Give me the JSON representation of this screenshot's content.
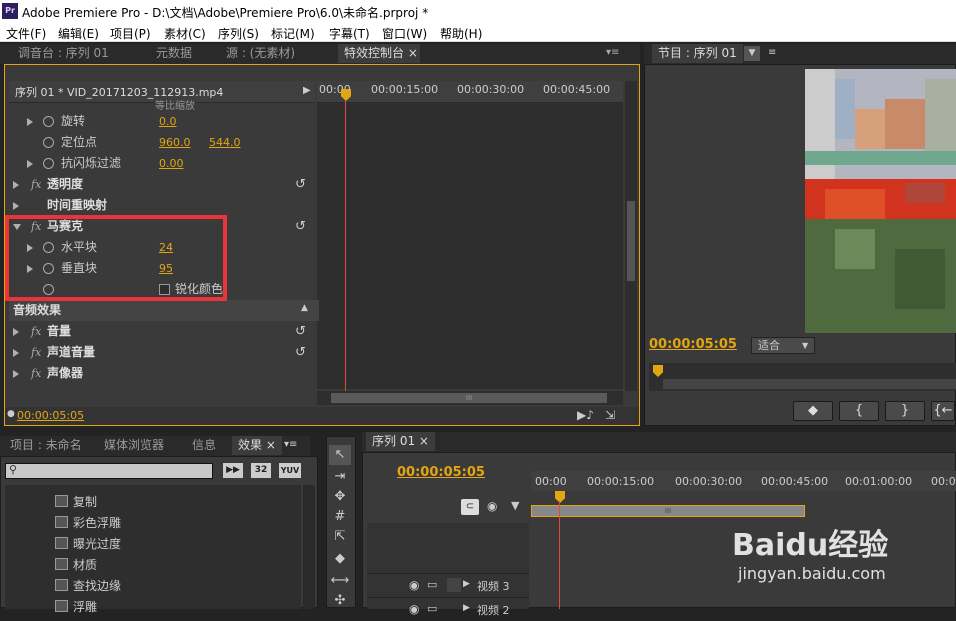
{
  "window": {
    "title": "Adobe Premiere Pro - D:\\文档\\Adobe\\Premiere Pro\\6.0\\未命名.prproj *",
    "logo": "Pr"
  },
  "menu": [
    "文件(F)",
    "编辑(E)",
    "项目(P)",
    "素材(C)",
    "序列(S)",
    "标记(M)",
    "字幕(T)",
    "窗口(W)",
    "帮助(H)"
  ],
  "top_tabs": [
    "调音台 : 序列 01",
    "元数据",
    "源 : (无素材)",
    "特效控制台"
  ],
  "effect_controls": {
    "clip": "序列 01 * VID_20171203_112913.mp4",
    "cut_text": "等比缩放",
    "ruler": [
      "00:00",
      "00:00:15:00",
      "00:00:30:00",
      "00:00:45:00"
    ],
    "rows": {
      "rotation": {
        "label": "旋转",
        "value": "0.0"
      },
      "anchor": {
        "label": "定位点",
        "x": "960.0",
        "y": "544.0"
      },
      "antiflicker": {
        "label": "抗闪烁过滤",
        "value": "0.00"
      },
      "opacity": "透明度",
      "time_remap": "时间重映射",
      "mosaic": "马赛克",
      "horizontal": {
        "label": "水平块",
        "value": "24"
      },
      "vertical": {
        "label": "垂直块",
        "value": "95"
      },
      "sharpen": {
        "label": "锐化颜色"
      },
      "audio_header": "音频效果",
      "volume": "音量",
      "channel_volume": "声道音量",
      "panner": "声像器"
    },
    "timecode": "00:00:05:05",
    "fx_label": "fx",
    "scroll_grip": "III"
  },
  "program": {
    "tab": "节目 : 序列 01",
    "timecode": "00:00:05:05",
    "fit": "适合",
    "buttons": [
      "◆",
      "{",
      "}",
      "{←"
    ]
  },
  "project": {
    "tabs": [
      "项目 : 未命名",
      "媒体浏览器",
      "信息",
      "效果"
    ],
    "search_placeholder": "",
    "icons": [
      "32",
      "YUV"
    ],
    "effects": [
      "复制",
      "彩色浮雕",
      "曝光过度",
      "材质",
      "查找边缘",
      "浮雕"
    ]
  },
  "timeline": {
    "tab": "序列 01",
    "timecode": "00:00:05:05",
    "ruler": [
      "00:00",
      "00:00:15:00",
      "00:00:30:00",
      "00:00:45:00",
      "00:01:00:00",
      "00:01:15:00"
    ],
    "tracks": [
      "视频 3",
      "视频 2"
    ]
  },
  "watermark": {
    "brand": "Baidu经验",
    "url": "jingyan.baidu.com"
  },
  "colors": {
    "accent": "#e2a613",
    "playhead": "#e8483a",
    "highlight_box": "#e8353a"
  }
}
